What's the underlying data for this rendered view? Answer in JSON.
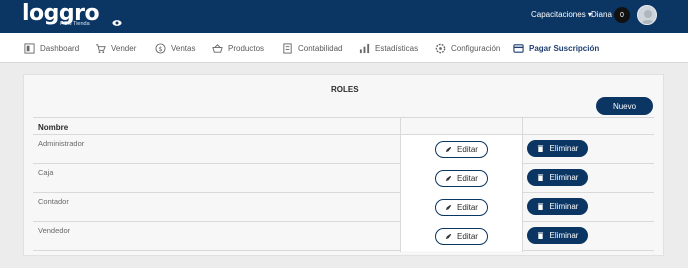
{
  "header": {
    "logo_text": "loggro",
    "logo_sub": "POS Tienda",
    "capacitaciones": "Capacitaciones ▾",
    "user": "Diana",
    "notifications": "0"
  },
  "nav": [
    {
      "label": "Dashboard",
      "icon": "dashboard-icon"
    },
    {
      "label": "Vender",
      "icon": "cart-icon"
    },
    {
      "label": "Ventas",
      "icon": "dollar-icon"
    },
    {
      "label": "Productos",
      "icon": "basket-icon"
    },
    {
      "label": "Contabilidad",
      "icon": "ledger-icon"
    },
    {
      "label": "Estadísticas",
      "icon": "bar-chart-icon"
    },
    {
      "label": "Configuración",
      "icon": "settings-icon"
    },
    {
      "label": "Pagar Suscripción",
      "icon": "credit-card-icon"
    }
  ],
  "page": {
    "title": "ROLES",
    "new_button": "Nuevo",
    "column_name": "Nombre",
    "edit_label": "Editar",
    "delete_label": "Eliminar",
    "roles": [
      "Administrador",
      "Caja",
      "Contador",
      "Vendedor"
    ]
  },
  "colors": {
    "primary": "#0b3563"
  }
}
